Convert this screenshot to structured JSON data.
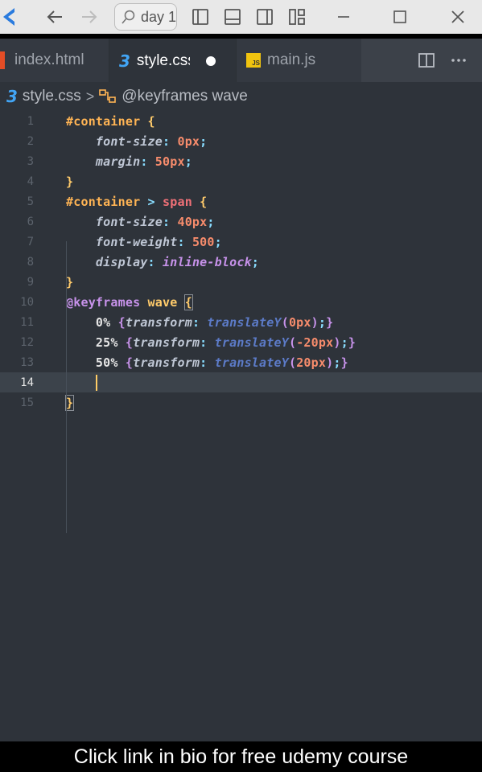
{
  "titlebar": {
    "search_text": "day 1",
    "colors": {
      "background": "#e8e8e8",
      "accent": "#2a7bde"
    },
    "icons": [
      "vscode-logo-icon",
      "back-arrow-icon",
      "forward-arrow-icon",
      "search-icon",
      "toggle-primary-sidebar-icon",
      "toggle-panel-icon",
      "toggle-secondary-sidebar-icon",
      "customize-layout-icon",
      "minimize-icon",
      "maximize-icon",
      "close-icon"
    ]
  },
  "tabs": [
    {
      "label": "index.html",
      "icon": "html-file-icon",
      "active": false
    },
    {
      "label": "style.css",
      "icon": "css-file-icon",
      "active": true,
      "modified": true
    },
    {
      "label": "main.js",
      "icon": "js-file-icon",
      "active": false
    }
  ],
  "breadcrumb": {
    "file": "style.css",
    "symbol": "@keyframes wave"
  },
  "editor": {
    "current_line": 14,
    "lines": [
      {
        "n": "1",
        "tokens": [
          [
            "t-sel",
            "#container"
          ],
          [
            "t-brace",
            " {"
          ]
        ]
      },
      {
        "n": "2",
        "tokens": [
          [
            "t-prop",
            "    font-size"
          ],
          [
            "t-punc",
            ": "
          ],
          [
            "t-num",
            "0px"
          ],
          [
            "t-punc",
            ";"
          ]
        ]
      },
      {
        "n": "3",
        "tokens": [
          [
            "t-prop",
            "    margin"
          ],
          [
            "t-punc",
            ": "
          ],
          [
            "t-num",
            "50px"
          ],
          [
            "t-punc",
            ";"
          ]
        ]
      },
      {
        "n": "4",
        "tokens": [
          [
            "t-brace",
            "}"
          ]
        ]
      },
      {
        "n": "5",
        "tokens": [
          [
            "t-sel",
            "#container"
          ],
          [
            "t-punc",
            " > "
          ],
          [
            "t-tag",
            "span"
          ],
          [
            "t-brace",
            " {"
          ]
        ]
      },
      {
        "n": "6",
        "tokens": [
          [
            "t-prop",
            "    font-size"
          ],
          [
            "t-punc",
            ": "
          ],
          [
            "t-num",
            "40px"
          ],
          [
            "t-punc",
            ";"
          ]
        ]
      },
      {
        "n": "7",
        "tokens": [
          [
            "t-prop",
            "    font-weight"
          ],
          [
            "t-punc",
            ": "
          ],
          [
            "t-num",
            "500"
          ],
          [
            "t-punc",
            ";"
          ]
        ]
      },
      {
        "n": "8",
        "tokens": [
          [
            "t-prop",
            "    display"
          ],
          [
            "t-punc",
            ": "
          ],
          [
            "t-val",
            "inline-block"
          ],
          [
            "t-punc",
            ";"
          ]
        ]
      },
      {
        "n": "9",
        "tokens": [
          [
            "t-brace",
            "}"
          ]
        ]
      },
      {
        "n": "10",
        "tokens": [
          [
            "t-kw",
            "@"
          ],
          [
            "t-kw",
            "keyframes "
          ],
          [
            "t-name",
            "wave "
          ],
          [
            "t-brace bracket-box",
            "{"
          ]
        ]
      },
      {
        "n": "11",
        "tokens": [
          [
            "t-pct",
            "    0% "
          ],
          [
            "t-pb",
            "{"
          ],
          [
            "t-prop",
            "transform"
          ],
          [
            "t-punc",
            ": "
          ],
          [
            "t-func",
            "translateY"
          ],
          [
            "t-pb",
            "("
          ],
          [
            "t-num",
            "0px"
          ],
          [
            "t-pb",
            ")"
          ],
          [
            "t-punc",
            ";"
          ],
          [
            "t-pb",
            "}"
          ]
        ]
      },
      {
        "n": "12",
        "tokens": [
          [
            "t-pct",
            "    25% "
          ],
          [
            "t-pb",
            "{"
          ],
          [
            "t-prop",
            "transform"
          ],
          [
            "t-punc",
            ": "
          ],
          [
            "t-func",
            "translateY"
          ],
          [
            "t-pb",
            "("
          ],
          [
            "t-num",
            "-20px"
          ],
          [
            "t-pb",
            ")"
          ],
          [
            "t-punc",
            ";"
          ],
          [
            "t-pb",
            "}"
          ]
        ]
      },
      {
        "n": "13",
        "tokens": [
          [
            "t-pct",
            "    50% "
          ],
          [
            "t-pb",
            "{"
          ],
          [
            "t-prop",
            "transform"
          ],
          [
            "t-punc",
            ": "
          ],
          [
            "t-func",
            "translateY"
          ],
          [
            "t-pb",
            "("
          ],
          [
            "t-num",
            "20px"
          ],
          [
            "t-pb",
            ")"
          ],
          [
            "t-punc",
            ";"
          ],
          [
            "t-pb",
            "}"
          ]
        ]
      },
      {
        "n": "14",
        "tokens": [
          [
            "t-punc",
            "    "
          ]
        ]
      },
      {
        "n": "15",
        "tokens": [
          [
            "t-brace bracket-box",
            "}"
          ]
        ]
      }
    ]
  },
  "caption": "Click link in bio for free udemy course"
}
